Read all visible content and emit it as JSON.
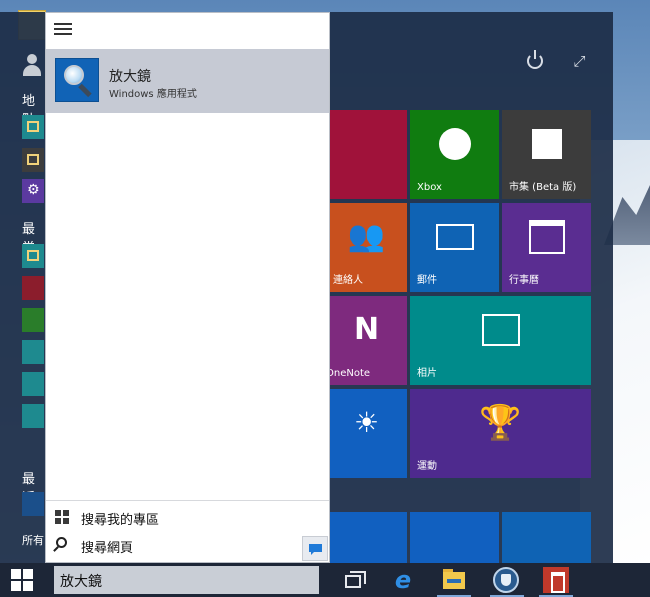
{
  "search_result": {
    "title": "放大鏡",
    "subtitle": "Windows 應用程式"
  },
  "search_actions": {
    "my_stuff": "搜尋我的專區",
    "web": "搜尋網頁"
  },
  "taskbar": {
    "search_value": "放大鏡"
  },
  "start_rail": {
    "places_label": "地點",
    "most_used_label": "最常",
    "recent_label": "最近",
    "all_apps_label": "所有"
  },
  "tiles": {
    "xbox": "Xbox",
    "store": "市集 (Beta 版)",
    "people": "連絡人",
    "mail": "郵件",
    "calendar": "行事曆",
    "onenote": "OneNote",
    "photos": "相片",
    "sports": "運動"
  },
  "colors": {
    "pane_bg": "#ffffff",
    "result_highlight": "#c6cad4",
    "taskbar": "#1d2637",
    "start_bg": "#1c2c46"
  }
}
